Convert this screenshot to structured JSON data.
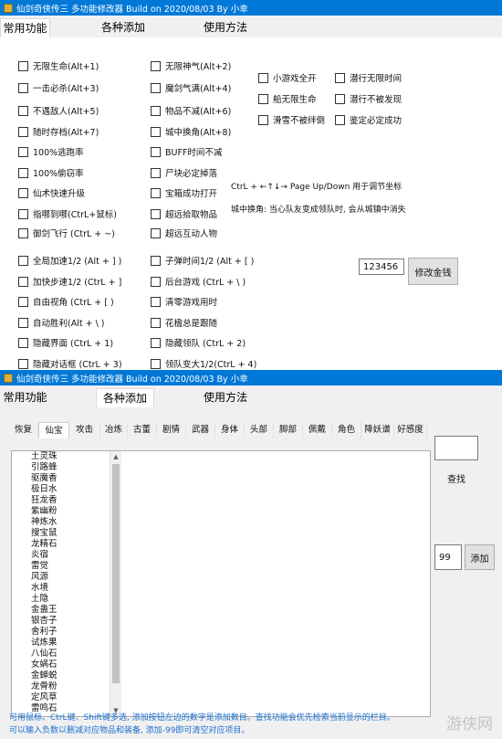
{
  "window_title": "仙剑奇侠传三 多功能修改器 Build on 2020/08/03 By 小幸",
  "tabs": [
    "常用功能",
    "各种添加",
    "使用方法"
  ],
  "common": {
    "col1": [
      "无限生命(Alt+1)",
      "一击必杀(Alt+3)",
      "不遇敌人(Alt+5)",
      "随时存档(Alt+7)",
      "100%逃跑率",
      "100%偷窃率",
      "仙术快速升级",
      "指哪到哪(CtrL+鼠标)",
      "御剑飞行 (CtrL + ~)"
    ],
    "col2": [
      "无限神气(Alt+2)",
      "魔剑气满(Alt+4)",
      "物品不减(Alt+6)",
      "城中换角(Alt+8)",
      "BUFF时间不减",
      "尸块必定掉落",
      "宝箱成功打开",
      "超远拾取物品",
      "超远互动人物"
    ],
    "col3": [
      "小游戏全开",
      "船无限生命",
      "滑雪不被绊倒"
    ],
    "col4": [
      "潜行无限时间",
      "潜行不被发现",
      "鉴定必定成功"
    ],
    "col5": [
      "全局加速1/2 (Alt + ] )",
      "加快步速1/2 (CtrL + ]",
      "自由视角 (CtrL + [ )",
      "自动胜利(Alt + \\ )",
      "隐藏界面 (CtrL + 1)",
      "隐藏对话框 (CtrL + 3)"
    ],
    "col6": [
      "子弹时间1/2 (Alt + [ )",
      "后台游戏 (CtrL + \\ )",
      "清零游戏用时",
      "花楹总是跟随",
      "隐藏领队 (CtrL + 2)",
      "领队变大1/2(CtrL + 4)"
    ],
    "note1": "CtrL + ←↑↓→ Page Up/Down 用于调节坐标",
    "note2": "城中换角: 当心队友变成领队时, 会从城镇中消失",
    "money_value": "123456",
    "money_button": "修改金钱"
  },
  "add": {
    "subtabs": [
      "恢复",
      "仙宝",
      "攻击",
      "冶炼",
      "古董",
      "剧情",
      "武器",
      "身体",
      "头部",
      "脚部",
      "佩戴",
      "角色",
      "降妖谱",
      "好感度"
    ],
    "items": [
      "土灵珠",
      "引路蜂",
      "驱魔香",
      "极日水",
      "狂龙香",
      "紫幽粉",
      "神炼水",
      "搜宝鼠",
      "龙精石",
      "炎宿",
      "雷觉",
      "风源",
      "水境",
      "土隐",
      "金蛊王",
      "银杏子",
      "舍利子",
      "试炼果",
      "八仙石",
      "女娲石",
      "金蝉蜕",
      "龙骨粉",
      "定风草",
      "雷鸣石"
    ],
    "search_value": "",
    "search_button": "查找",
    "count_value": "99",
    "add_button": "添加",
    "footer1": "可用鼠标、CtrL键、Shift键多选, 添加按钮左边的数字是添加数目。查找功能会优先检索当前显示的栏目。",
    "footer2": "可以输入负数以删减对应物品和装备, 添加-99即可清空对应项目。",
    "watermark": "游侠网"
  }
}
